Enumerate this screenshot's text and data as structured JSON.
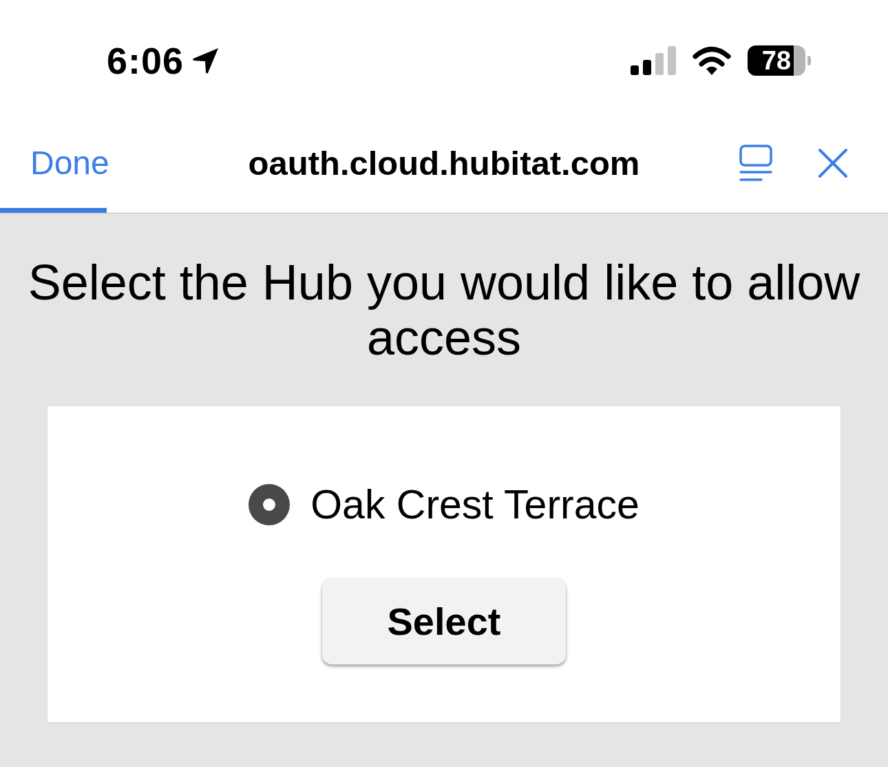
{
  "status_bar": {
    "time": "6:06",
    "battery": "78"
  },
  "browser_bar": {
    "done": "Done",
    "url": "oauth.cloud.hubitat.com",
    "progress": {
      "level": 0.12
    }
  },
  "page": {
    "heading": "Select the Hub you would like to allow access",
    "hubs": [
      {
        "label": "Oak Crest Terrace",
        "selected": true
      }
    ],
    "button": "Select"
  }
}
